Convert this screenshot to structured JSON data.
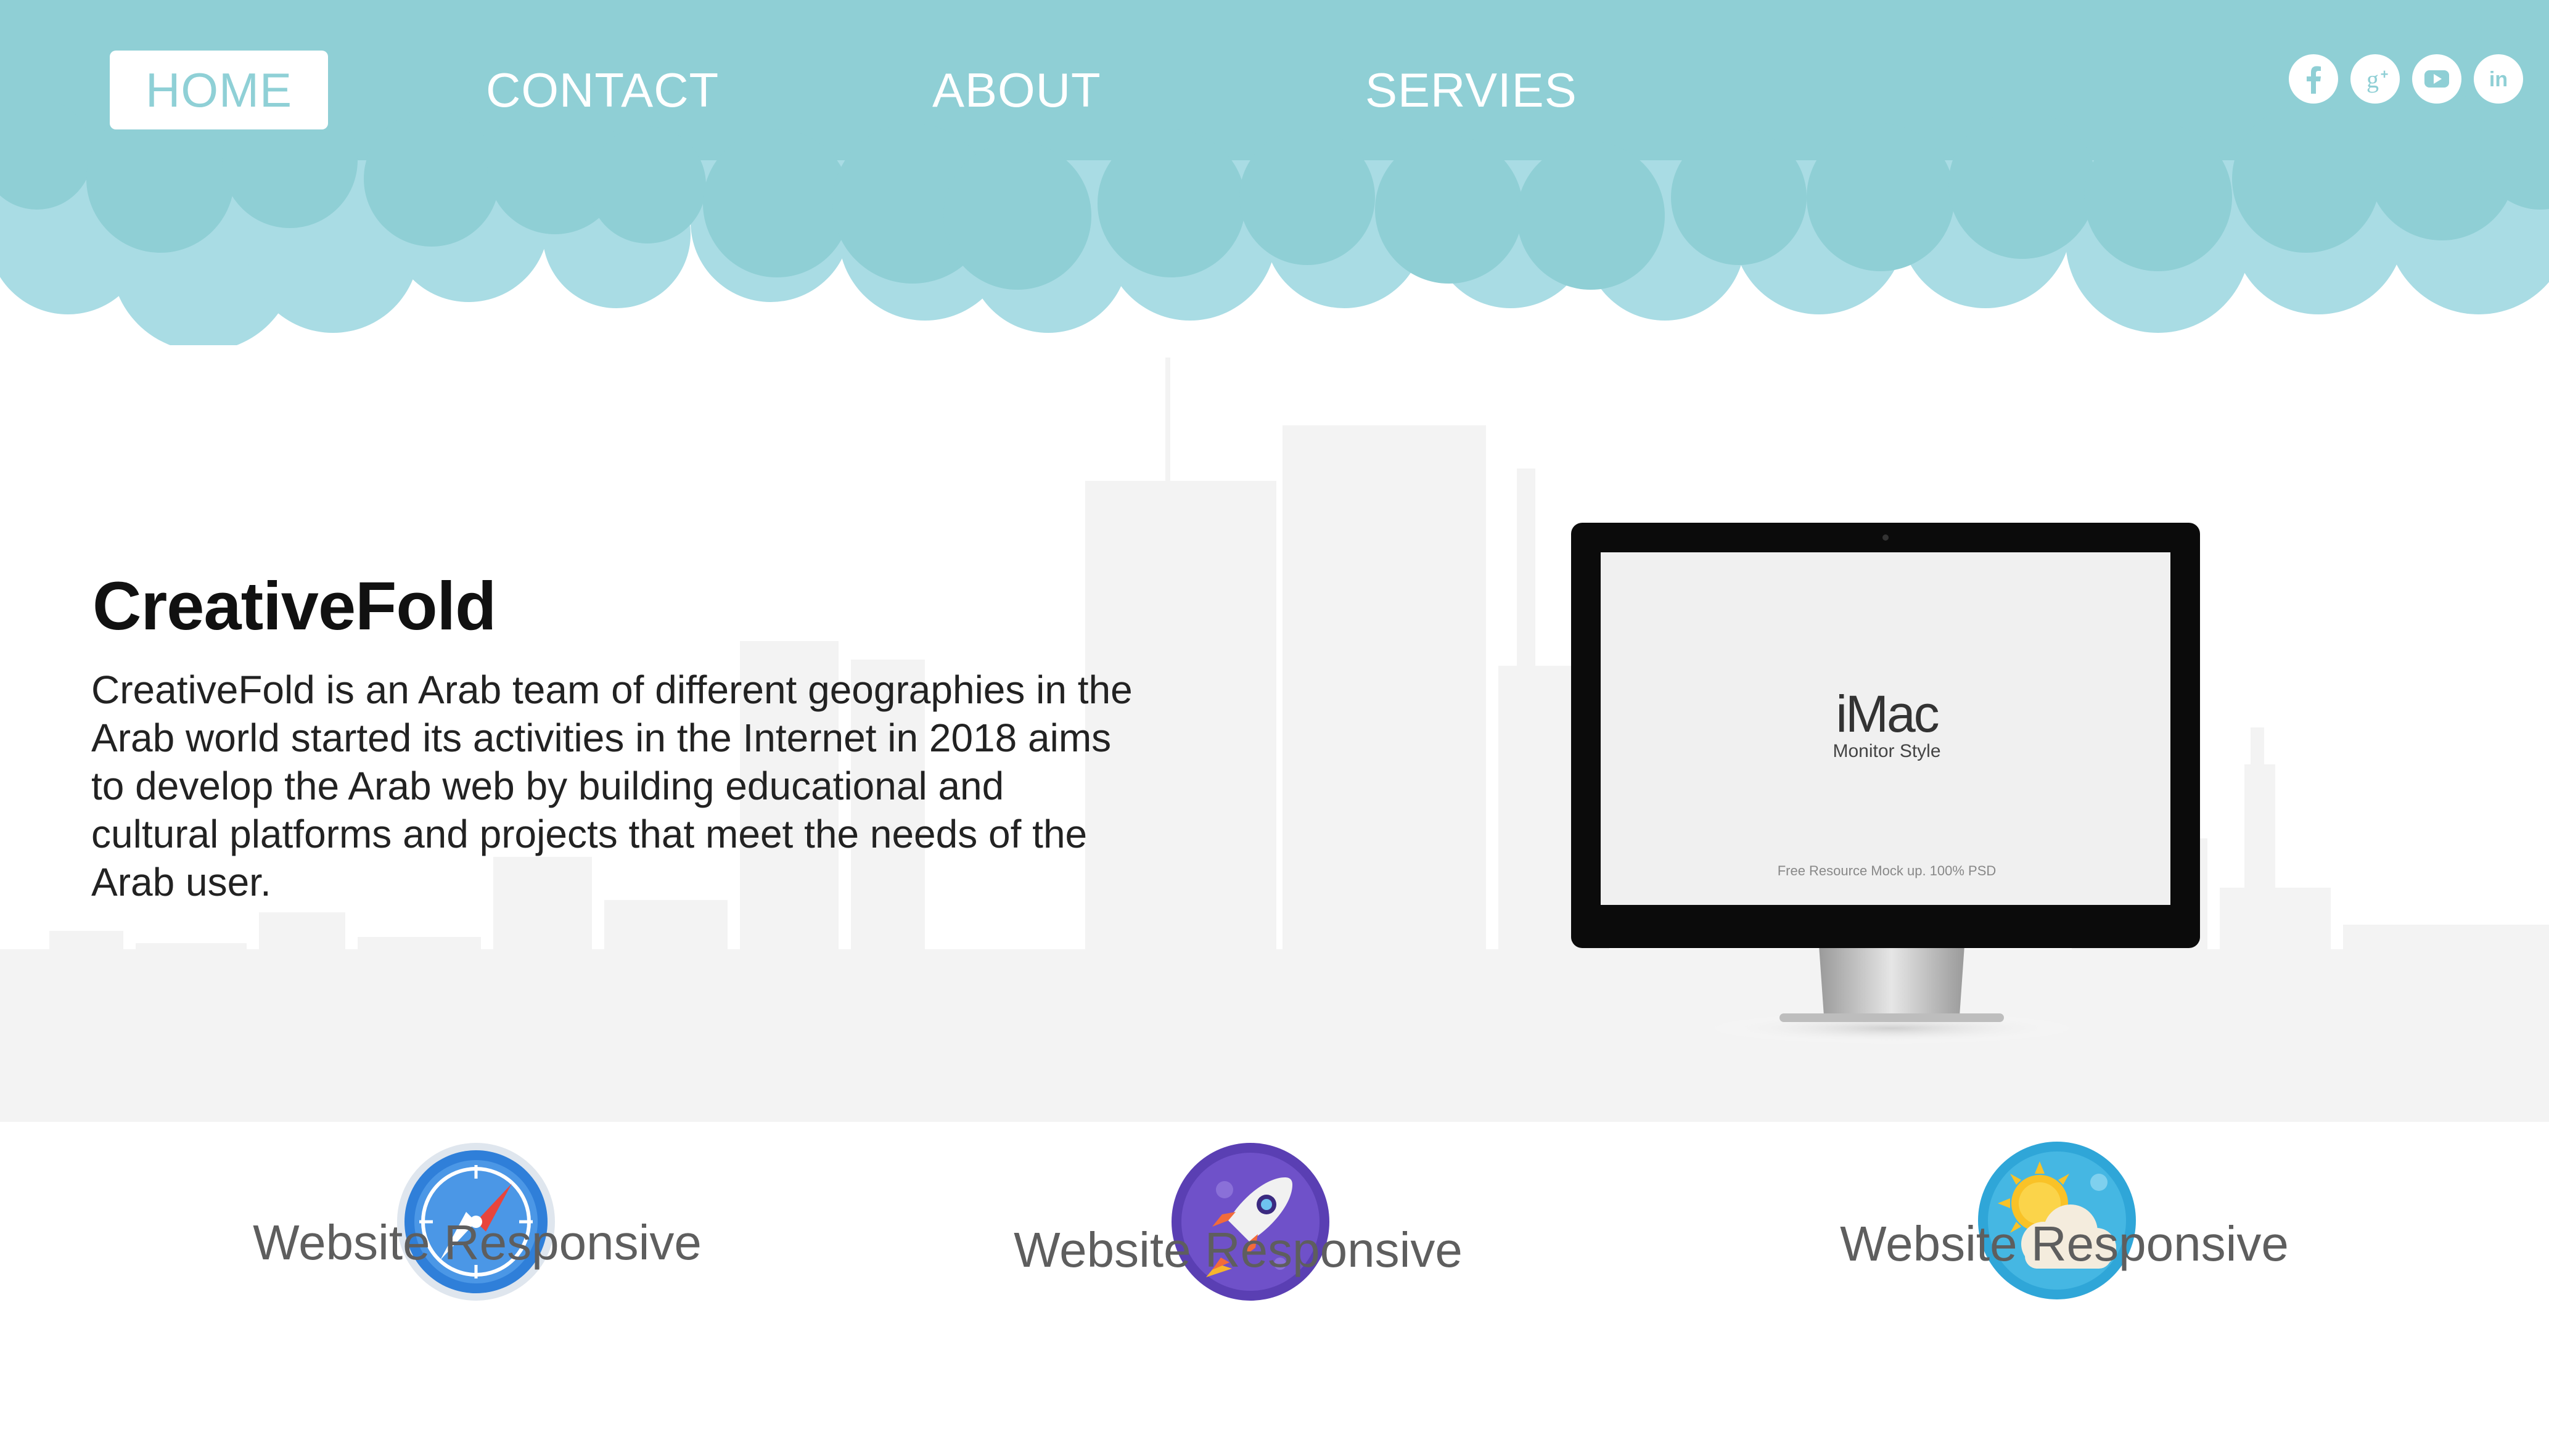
{
  "nav": {
    "items": [
      {
        "label": "HOME",
        "active": true
      },
      {
        "label": "CONTACT",
        "active": false
      },
      {
        "label": "ABOUT",
        "active": false
      },
      {
        "label": "SERVIES",
        "active": false
      }
    ]
  },
  "social": {
    "icons": [
      "facebook-icon",
      "google-plus-icon",
      "youtube-icon",
      "linkedin-icon"
    ]
  },
  "hero": {
    "title": "CreativeFold",
    "text": "CreativeFold is an Arab team of different geographies in the Arab world started its activities in the Internet in 2018 aims to develop the Arab web by building educational and cultural platforms and projects that meet the needs of the Arab user."
  },
  "monitor": {
    "brand": "iMac",
    "subtitle": "Monitor Style",
    "footer": "Free Resource Mock up.  100% PSD"
  },
  "features": [
    {
      "icon": "compass-icon",
      "label": "Website Responsive"
    },
    {
      "icon": "rocket-icon",
      "label": "Website Responsive"
    },
    {
      "icon": "sun-cloud-icon",
      "label": "Website Responsive"
    }
  ],
  "colors": {
    "header_cloud": "#8fcfd5",
    "header_cloud_light": "#a9dce4",
    "text_dark": "#111111",
    "feature_text": "#5e5e5e",
    "skyline": "#f2f2f2"
  }
}
